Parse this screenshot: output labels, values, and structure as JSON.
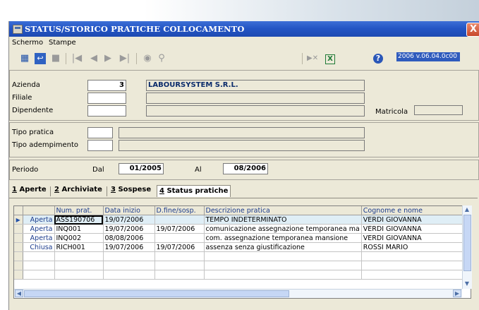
{
  "window": {
    "title": "STATUS/STORICO PRATICHE COLLOCAMENTO",
    "close": "X"
  },
  "menu": [
    "Schermo",
    "Stampe"
  ],
  "toolbar": {
    "version": "2006 v.06.04.0c00"
  },
  "form": {
    "azienda_label": "Azienda",
    "azienda_code": "3",
    "azienda_name": "LABOURSYSTEM S.R.L.",
    "filiale_label": "Filiale",
    "dipendente_label": "Dipendente",
    "matricola_label": "Matricola",
    "tipo_pratica_label": "Tipo pratica",
    "tipo_adempimento_label": "Tipo adempimento",
    "periodo_label": "Periodo",
    "dal_label": "Dal",
    "dal_value": "01/2005",
    "al_label": "Al",
    "al_value": "08/2006"
  },
  "tabs": [
    {
      "num": "1",
      "label": "Aperte"
    },
    {
      "num": "2",
      "label": "Archiviate"
    },
    {
      "num": "3",
      "label": "Sospese"
    },
    {
      "num": "4",
      "label": "Status pratiche"
    }
  ],
  "grid": {
    "columns": [
      "Num. prat.",
      "Data inizio",
      "D.fine/sosp.",
      "Descrizione pratica",
      "Cognome e nome"
    ],
    "rows": [
      {
        "indicator": "▶",
        "status": "Aperta",
        "num": "ASS190706",
        "start": "19/07/2006",
        "end": "",
        "desc": "TEMPO INDETERMINATO",
        "name": "VERDI GIOVANNA"
      },
      {
        "indicator": "",
        "status": "Aperta",
        "num": "INQ001",
        "start": "19/07/2006",
        "end": "19/07/2006",
        "desc": "comunicazione assegnazione temporanea ma",
        "name": "VERDI GIOVANNA"
      },
      {
        "indicator": "",
        "status": "Aperta",
        "num": "INQ002",
        "start": "08/08/2006",
        "end": "",
        "desc": "com. assegnazione temporanea mansione",
        "name": "VERDI GIOVANNA"
      },
      {
        "indicator": "",
        "status": "Chiusa",
        "num": "RICH001",
        "start": "19/07/2006",
        "end": "19/07/2006",
        "desc": "assenza senza giustificazione",
        "name": "ROSSI MARIO"
      }
    ]
  },
  "colors": {
    "titlebar": "#2456c5",
    "window": "#ece9d8",
    "selected_row": "#dfeef6",
    "grid_header_text": "#1b3b8c"
  }
}
